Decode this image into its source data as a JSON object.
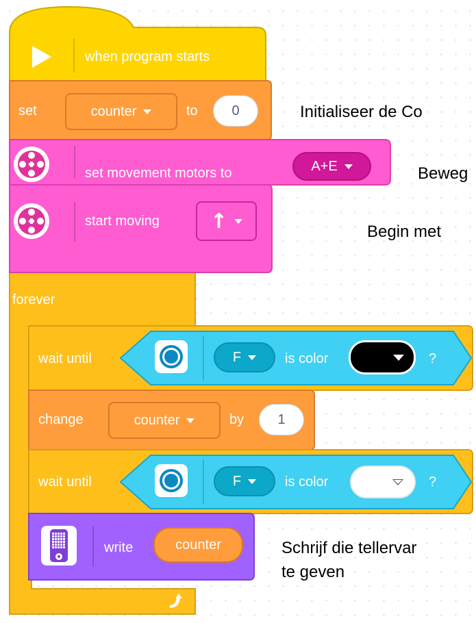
{
  "hat_block": {
    "label": "when program starts"
  },
  "set_block": {
    "keyword": "set",
    "variable": "counter",
    "to_word": "to",
    "value": "0"
  },
  "annotation_set": "Initialiseer de Co",
  "movement_block": {
    "label": "set movement motors to",
    "ports": "A+E"
  },
  "annotation_movement": "Beweg",
  "start_block": {
    "label": "start moving",
    "direction": "↑"
  },
  "annotation_start": "Begin met",
  "forever_block": {
    "label": "forever"
  },
  "wait_block_1": {
    "prefix": "wait until",
    "port": "F",
    "middle": "is color",
    "color": "black",
    "suffix": "?"
  },
  "change_block": {
    "keyword": "change",
    "variable": "counter",
    "by_word": "by",
    "value": "1"
  },
  "wait_block_2": {
    "prefix": "wait until",
    "port": "F",
    "middle": "is color",
    "color": "white",
    "suffix": "?"
  },
  "write_block": {
    "label": "write",
    "value": "counter"
  },
  "annotation_write": {
    "line1": "Schrijf die tellervar",
    "line2": "te geven"
  },
  "colors": {
    "events": "#ffd500",
    "events_border": "#ccaa00",
    "variables": "#ff9d3c",
    "variables_border": "#d9792a",
    "movement": "#ff5cd2",
    "movement_border": "#d93fae",
    "control": "#ffbf1b",
    "control_border": "#d99e10",
    "sensor": "#3fd0f3",
    "sensor_border": "#1aa5c8",
    "display": "#a161ff",
    "display_border": "#7d3fd6"
  },
  "icons": [
    "play-icon",
    "motor-icon",
    "color-sensor-icon",
    "hub-display-icon",
    "loop-arrow-icon",
    "dropdown-caret-icon"
  ]
}
